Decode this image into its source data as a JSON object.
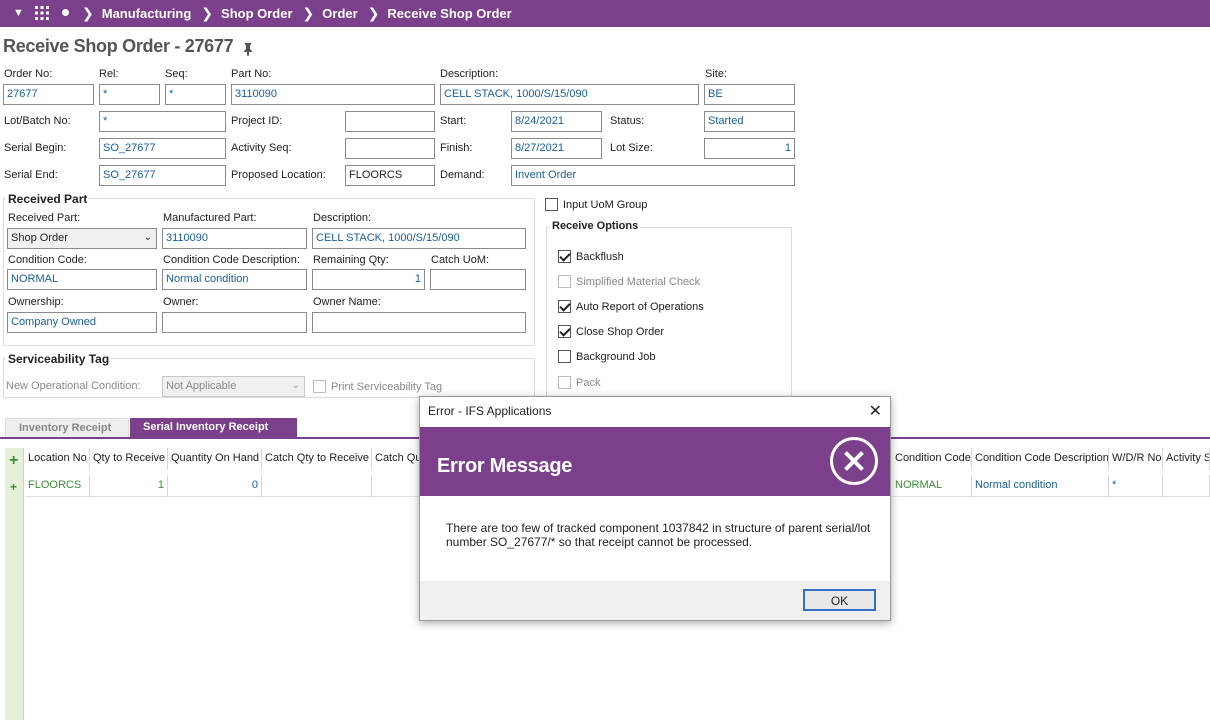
{
  "nav": {
    "breadcrumbs": [
      "Manufacturing",
      "Shop Order",
      "Order",
      "Receive Shop Order"
    ]
  },
  "page": {
    "title": "Receive Shop Order - 27677"
  },
  "header": {
    "order_no_label": "Order No:",
    "order_no": "27677",
    "rel_label": "Rel:",
    "rel": "*",
    "seq_label": "Seq:",
    "seq": "*",
    "part_no_label": "Part No:",
    "part_no": "3110090",
    "description_label": "Description:",
    "description": "CELL STACK, 1000/S/15/090",
    "site_label": "Site:",
    "site": "BE",
    "lot_batch_label": "Lot/Batch No:",
    "lot_batch": "*",
    "project_id_label": "Project ID:",
    "project_id": "",
    "start_label": "Start:",
    "start": "8/24/2021",
    "status_label": "Status:",
    "status": "Started",
    "serial_begin_label": "Serial Begin:",
    "serial_begin": "SO_27677",
    "activity_seq_label": "Activity Seq:",
    "activity_seq": "",
    "finish_label": "Finish:",
    "finish": "8/27/2021",
    "lot_size_label": "Lot Size:",
    "lot_size": "1",
    "serial_end_label": "Serial End:",
    "serial_end": "SO_27677",
    "proposed_location_label": "Proposed Location:",
    "proposed_location": "FLOORCS",
    "demand_label": "Demand:",
    "demand": "Invent Order"
  },
  "received_part": {
    "group_title": "Received Part",
    "received_part_label": "Received Part:",
    "received_part": "Shop Order",
    "manufactured_part_label": "Manufactured Part:",
    "manufactured_part": "3110090",
    "description_label": "Description:",
    "description": "CELL STACK, 1000/S/15/090",
    "condition_code_label": "Condition Code:",
    "condition_code": "NORMAL",
    "condition_desc_label": "Condition Code Description:",
    "condition_desc": "Normal condition",
    "remaining_qty_label": "Remaining Qty:",
    "remaining_qty": "1",
    "catch_uom_label": "Catch UoM:",
    "catch_uom": "",
    "ownership_label": "Ownership:",
    "ownership": "Company Owned",
    "owner_label": "Owner:",
    "owner": "",
    "owner_name_label": "Owner Name:",
    "owner_name": ""
  },
  "serviceability": {
    "group_title": "Serviceability Tag",
    "new_op_condition_label": "New Operational Condition:",
    "new_op_condition": "Not Applicable",
    "print_tag_label": "Print Serviceability Tag"
  },
  "options": {
    "input_uom_group_label": "Input UoM Group",
    "group_title": "Receive Options",
    "items": [
      {
        "label": "Backflush",
        "checked": true,
        "disabled": false
      },
      {
        "label": "Simplified Material Check",
        "checked": false,
        "disabled": true
      },
      {
        "label": "Auto Report of Operations",
        "checked": true,
        "disabled": false
      },
      {
        "label": "Close Shop Order",
        "checked": true,
        "disabled": false
      },
      {
        "label": "Background Job",
        "checked": false,
        "disabled": false
      },
      {
        "label": "Pack",
        "checked": false,
        "disabled": true
      }
    ]
  },
  "tabs": [
    {
      "label": "Inventory Receipt",
      "active": false
    },
    {
      "label": "Serial Inventory Receipt",
      "active": true
    }
  ],
  "grid": {
    "columns_left": [
      "Location No",
      "Qty to Receive",
      "Quantity On Hand",
      "Catch Qty to Receive",
      "Catch Qu"
    ],
    "columns_right": [
      "Condition Code",
      "Condition Code Description",
      "W/D/R No",
      "Activity S"
    ],
    "row": {
      "location_no": "FLOORCS",
      "qty_to_receive": "1",
      "qty_on_hand": "0",
      "condition_code": "NORMAL",
      "condition_desc": "Normal condition",
      "wdr_no": "*"
    }
  },
  "dialog": {
    "window_title": "Error - IFS Applications",
    "heading": "Error Message",
    "message": "There are too few of tracked component 1037842 in structure of parent serial/lot number SO_27677/* so that receipt cannot be processed.",
    "ok_label": "OK"
  },
  "colors": {
    "brand": "#7b3f8c",
    "value_text": "#1a5fa0",
    "green": "#3a8f3a"
  }
}
